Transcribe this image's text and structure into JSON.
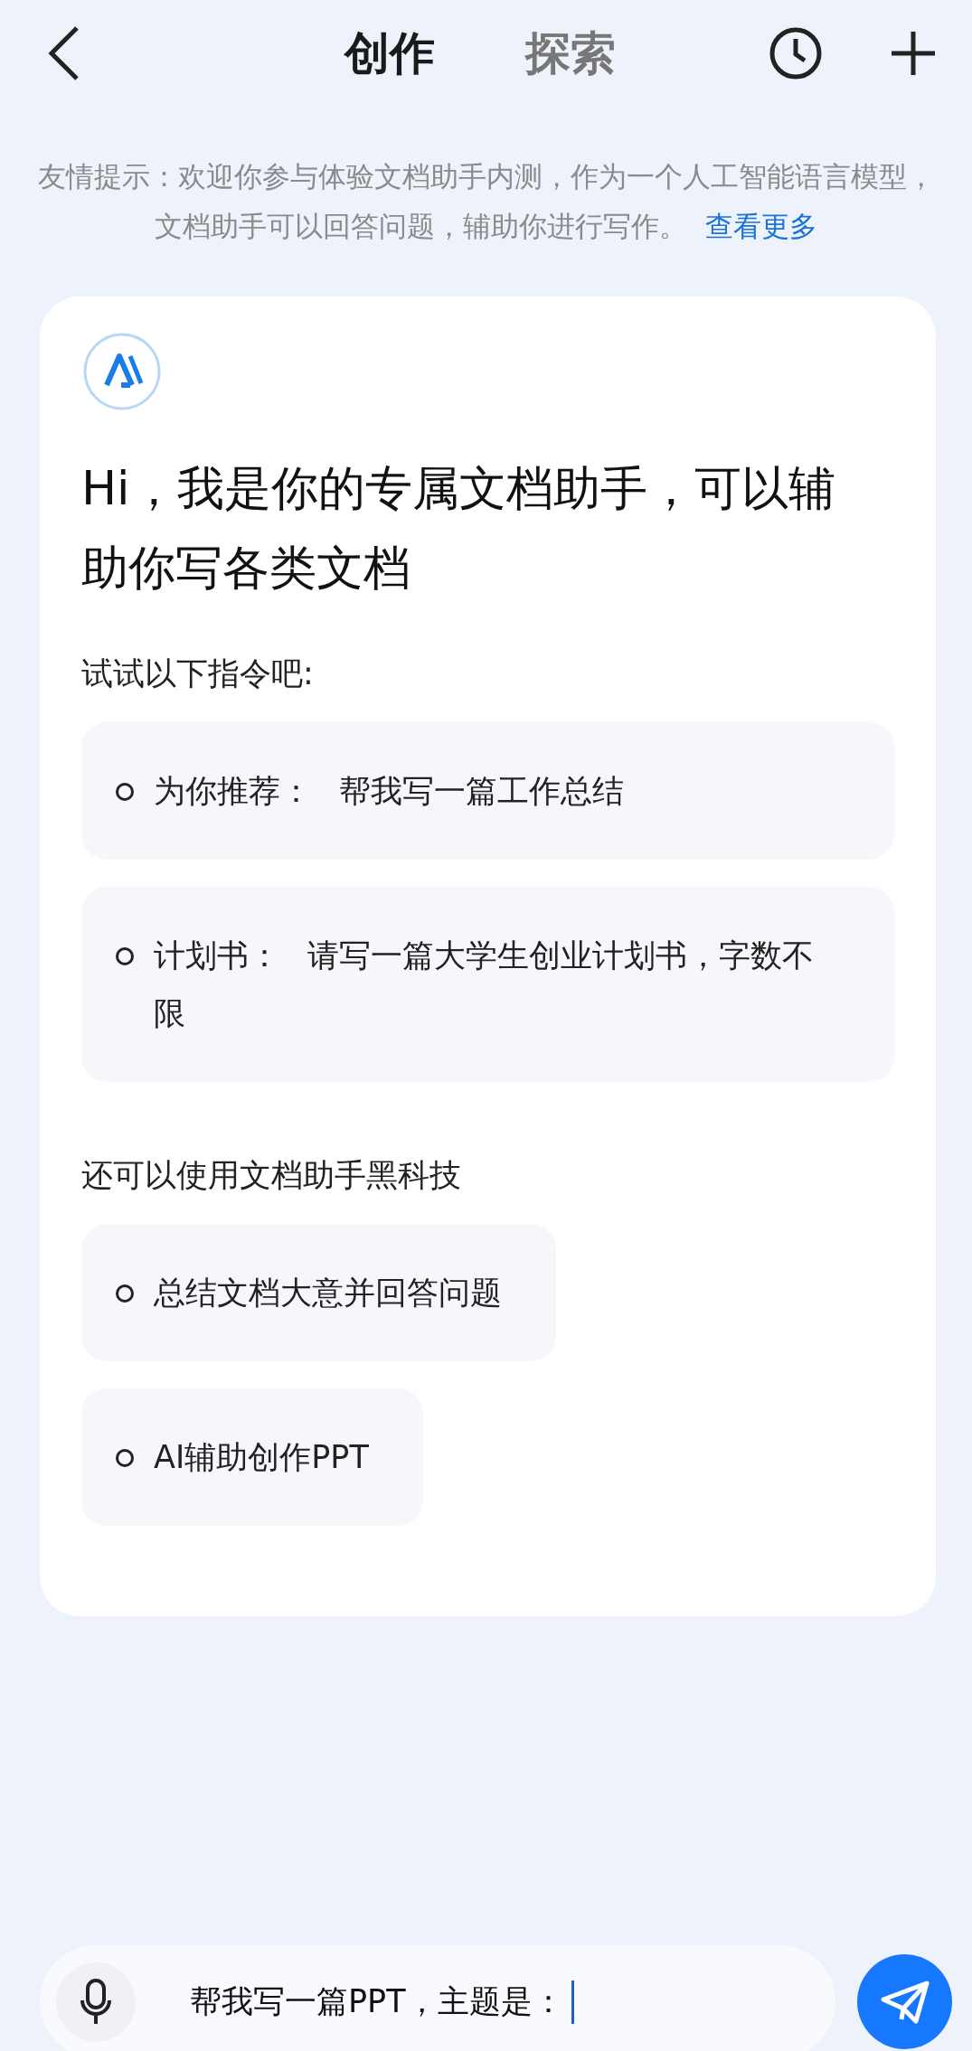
{
  "header": {
    "tabs": [
      {
        "label": "创作",
        "selected": true
      },
      {
        "label": "探索",
        "selected": false
      }
    ]
  },
  "tip": {
    "text": "友情提示：欢迎你参与体验文档助手内测，作为一个人工智能语言模型，文档助手可以回答问题，辅助你进行写作。",
    "link": "查看更多"
  },
  "card": {
    "greeting": "Hi，我是你的专属文档助手，可以辅助你写各类文档",
    "sections": [
      {
        "heading": "试试以下指令吧:",
        "items": [
          {
            "prefix": "为你推荐：",
            "text": "帮我写一篇工作总结"
          },
          {
            "prefix": "计划书：",
            "text": "请写一篇大学生创业计划书，字数不限"
          }
        ]
      },
      {
        "heading": "还可以使用文档助手黑科技",
        "items": [
          {
            "text": "总结文档大意并回答问题"
          },
          {
            "text": "AI辅助创作PPT"
          }
        ]
      }
    ]
  },
  "input": {
    "value": "帮我写一篇PPT，主题是："
  }
}
